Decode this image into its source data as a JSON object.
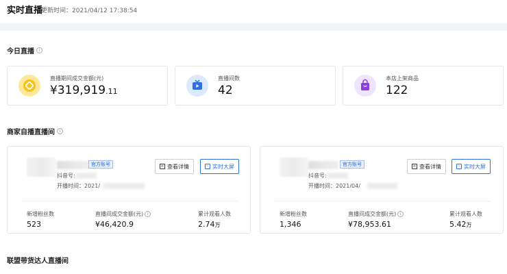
{
  "header": {
    "title": "实时直播",
    "updated_label": "更新时间：2021/04/12 17:38:54"
  },
  "colors": {
    "accent_blue": "#2f6fde",
    "gmv_icon_bg": "#ffe89a",
    "rooms_icon_bg": "#dbeafe",
    "goods_icon_bg": "#efe4ff"
  },
  "today": {
    "title": "今日直播",
    "info_icon": "info-icon",
    "cards": [
      {
        "label": "直播期间成交金额(元)",
        "value_main": "¥319,919",
        "value_small": ".11",
        "icon": "coin-icon"
      },
      {
        "label": "直播间数",
        "value_main": "42",
        "value_small": "",
        "icon": "tv-icon"
      },
      {
        "label": "本店上架商品",
        "value_main": "122",
        "value_small": "",
        "icon": "shopping-bag-icon"
      }
    ]
  },
  "merchant": {
    "title": "商家自播直播间",
    "rooms": [
      {
        "badge": "官方账号",
        "account_label": "抖音号:",
        "start_label": "开播时间：2021/",
        "detail_button": "查看详情",
        "screen_button": "实时大屏",
        "metrics": [
          {
            "label": "新增粉丝数",
            "value_main": "523",
            "value_small": "",
            "info": false
          },
          {
            "label": "直播间成交金额(元)",
            "value_main": "¥46,420.9",
            "value_small": "",
            "info": true
          },
          {
            "label": "累计观看人数",
            "value_main": "2.74",
            "value_small": "万",
            "info": false
          }
        ]
      },
      {
        "badge": "官方账号",
        "account_label": "抖音号:",
        "start_label": "开播时间：2021/04/",
        "detail_button": "查看详情",
        "screen_button": "实时大屏",
        "metrics": [
          {
            "label": "新增粉丝数",
            "value_main": "1,346",
            "value_small": "",
            "info": false
          },
          {
            "label": "直播间成交金额(元)",
            "value_main": "¥78,953.61",
            "value_small": "",
            "info": true
          },
          {
            "label": "累计观看人数",
            "value_main": "5.42",
            "value_small": "万",
            "info": false
          }
        ]
      }
    ]
  },
  "alliance": {
    "title": "联盟带货达人直播间"
  }
}
